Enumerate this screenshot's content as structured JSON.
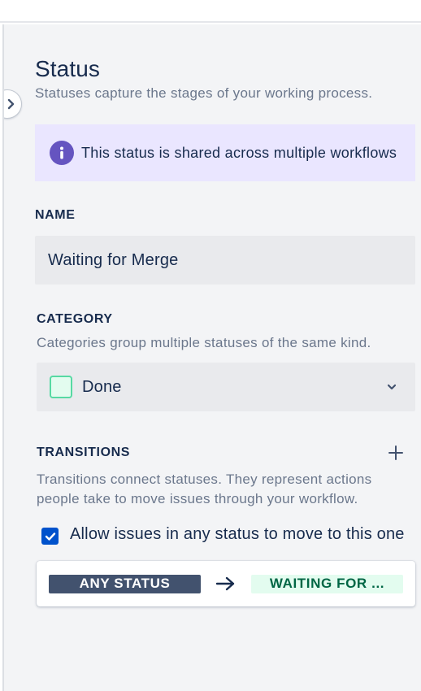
{
  "panel": {
    "title": "Status",
    "subtitle": "Statuses capture the stages of your working process.",
    "banner": {
      "icon": "info-icon",
      "text": "This status is shared across multiple workflows"
    }
  },
  "name_section": {
    "label": "NAME",
    "value": "Waiting for Merge"
  },
  "category_section": {
    "label": "CATEGORY",
    "description": "Categories group multiple statuses of the same kind.",
    "selected": "Done",
    "swatch_border": "#57d9a3",
    "swatch_fill": "#e3fcef"
  },
  "transitions_section": {
    "label": "TRANSITIONS",
    "description": "Transitions connect statuses. They represent actions people take to move issues through your workflow.",
    "checkbox_label": "Allow issues in any status to move to this one",
    "checkbox_checked": true,
    "from_label": "ANY STATUS",
    "to_label": "WAITING FOR ..."
  },
  "colors": {
    "accent": "#0052cc",
    "info": "#6554c0",
    "banner_bg": "#eae6ff",
    "done_text": "#006644"
  }
}
